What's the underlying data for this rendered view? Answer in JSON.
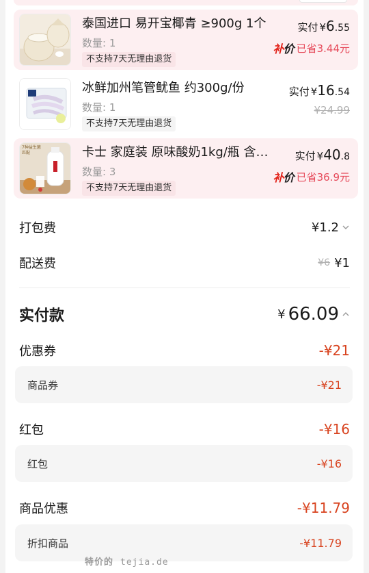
{
  "products": [
    {
      "name": "泰国进口 易开宝椰青 ≥900g 1个",
      "qty": "数量: 1",
      "tag": "不支持7天无理由退货",
      "pay_label": "实付",
      "pay_yen": "¥",
      "pay_int": "6",
      "pay_dec": ".55",
      "badge_a": "补",
      "badge_b": "价",
      "saved": "已省3.44元",
      "image": "coconut-product-image"
    },
    {
      "name": "冰鲜加州笔管鱿鱼 约300g/份",
      "qty": "数量: 1",
      "tag": "不支持7天无理由退货",
      "pay_label": "实付",
      "pay_yen": "¥",
      "pay_int": "16",
      "pay_dec": ".54",
      "original": "¥24.99",
      "image": "squid-product-image"
    },
    {
      "name": "卡士 家庭装 原味酸奶1kg/瓶 含…",
      "qty": "数量: 3",
      "tag": "不支持7天无理由退货",
      "pay_label": "实付",
      "pay_yen": "¥",
      "pay_int": "40",
      "pay_dec": ".8",
      "badge_a": "补",
      "badge_b": "价",
      "saved": "已省36.9元",
      "image": "yogurt-product-image",
      "image_text": "7种益生菌 匹配"
    }
  ],
  "fees": {
    "packing_label": "打包费",
    "packing_value": "¥1.2",
    "delivery_label": "配送费",
    "delivery_original": "¥6",
    "delivery_value": "¥1"
  },
  "total": {
    "label": "实付款",
    "yen": "¥",
    "value": "66.09"
  },
  "discounts": {
    "coupon_label": "优惠券",
    "coupon_value": "-¥21",
    "coupon_sub_label": "商品券",
    "coupon_sub_value": "-¥21",
    "redpacket_label": "红包",
    "redpacket_value": "-¥16",
    "redpacket_sub_label": "红包",
    "redpacket_sub_value": "-¥16",
    "product_label": "商品优惠",
    "product_value": "-¥11.79",
    "product_sub_label": "折扣商品",
    "product_sub_value": "-¥11.79"
  },
  "watermark": {
    "cn": "特价的",
    "domain": "tejia.de"
  },
  "colors": {
    "highlight_bg": "#fdeff1",
    "accent_red": "#d8431f",
    "saved_pink": "#e64a5a"
  }
}
